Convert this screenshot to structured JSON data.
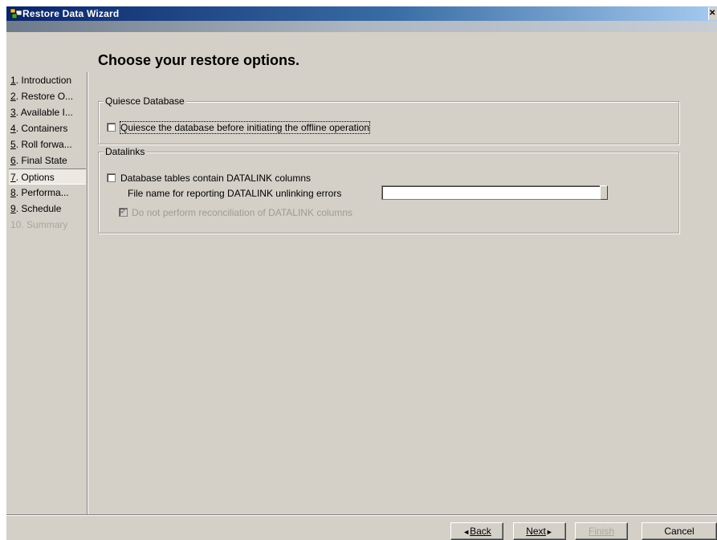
{
  "window": {
    "title": "Restore Data Wizard",
    "close_glyph": "✕"
  },
  "steps": [
    {
      "num": "1",
      "label": ". Introduction",
      "state": "normal"
    },
    {
      "num": "2",
      "label": ". Restore O...",
      "state": "normal"
    },
    {
      "num": "3",
      "label": ". Available I...",
      "state": "normal"
    },
    {
      "num": "4",
      "label": ". Containers",
      "state": "normal"
    },
    {
      "num": "5",
      "label": ". Roll forwa...",
      "state": "normal"
    },
    {
      "num": "6",
      "label": ". Final State",
      "state": "normal"
    },
    {
      "num": "7",
      "label": ". Options",
      "state": "current"
    },
    {
      "num": "8",
      "label": ". Performa...",
      "state": "normal"
    },
    {
      "num": "9",
      "label": ". Schedule",
      "state": "normal"
    },
    {
      "num": "10",
      "label": ". Summary",
      "state": "disabled"
    }
  ],
  "main": {
    "title": "Choose your restore options.",
    "quiesce": {
      "legend": "Quiesce Database",
      "checkbox_label": "Quiesce the database before initiating the offline operation",
      "checked": false
    },
    "datalinks": {
      "legend": "Datalinks",
      "tables_label": "Database tables contain DATALINK columns",
      "tables_checked": false,
      "file_label": "File name for reporting DATALINK unlinking errors",
      "file_value": "",
      "reconcile_label": "Do not perform reconciliation of DATALINK columns",
      "reconcile_checked": true,
      "reconcile_mark": "✔"
    }
  },
  "buttons": {
    "back_arrow": "◄",
    "back": "Back",
    "next": "Next",
    "next_arrow": "►",
    "finish": "Finish",
    "cancel": "Cancel"
  },
  "colors": {
    "titlebar": "#0a246a",
    "dialog": "#d4d0c8",
    "disabled_text": "#a8a59e"
  }
}
